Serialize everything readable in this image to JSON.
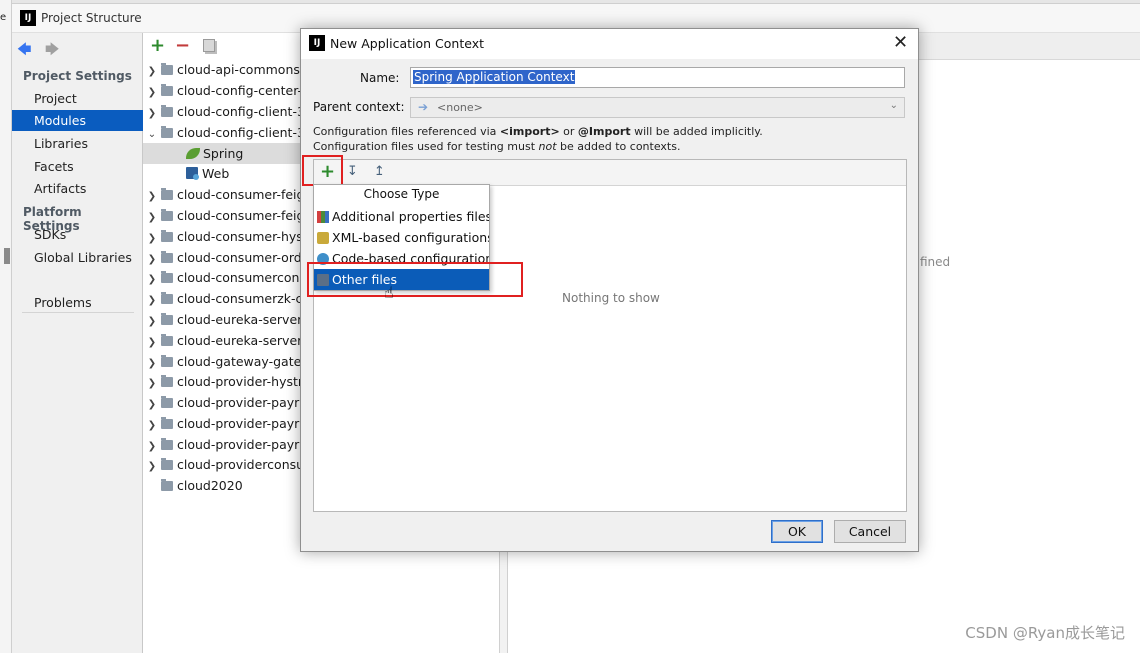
{
  "window": {
    "title": "Project Structure",
    "logo": "IJ",
    "left_fragment": "e"
  },
  "sidebar": {
    "project_settings_header": "Project Settings",
    "project_items": [
      {
        "label": "Project"
      },
      {
        "label": "Modules"
      },
      {
        "label": "Libraries"
      },
      {
        "label": "Facets"
      },
      {
        "label": "Artifacts"
      }
    ],
    "platform_settings_header": "Platform Settings",
    "platform_items": [
      {
        "label": "SDKs"
      },
      {
        "label": "Global Libraries"
      }
    ],
    "problems": "Problems",
    "selected": "Modules"
  },
  "tree": {
    "rows": [
      {
        "label": "cloud-api-commons"
      },
      {
        "label": "cloud-config-center-"
      },
      {
        "label": "cloud-config-client-3"
      },
      {
        "label": "cloud-config-client-3"
      },
      {
        "label": "Spring"
      },
      {
        "label": "Web"
      },
      {
        "label": "cloud-consumer-feig"
      },
      {
        "label": "cloud-consumer-feig"
      },
      {
        "label": "cloud-consumer-hys"
      },
      {
        "label": "cloud-consumer-ord"
      },
      {
        "label": "cloud-consumercons"
      },
      {
        "label": "cloud-consumerzk-c"
      },
      {
        "label": "cloud-eureka-server"
      },
      {
        "label": "cloud-eureka-server"
      },
      {
        "label": "cloud-gateway-gatev"
      },
      {
        "label": "cloud-provider-hystr"
      },
      {
        "label": "cloud-provider-payr"
      },
      {
        "label": "cloud-provider-payr"
      },
      {
        "label": "cloud-provider-payr"
      },
      {
        "label": "cloud-providerconsu"
      },
      {
        "label": "cloud2020"
      }
    ]
  },
  "right_panel": {
    "fragment": "fined"
  },
  "dialog": {
    "title": "New Application Context",
    "logo": "IJ",
    "name_label": "Name:",
    "name_value": "Spring Application Context",
    "parent_label": "Parent context:",
    "parent_value": "<none>",
    "info_line1": {
      "a": "Configuration files referenced via ",
      "b": "<import>",
      "c": " or ",
      "d": "@Import",
      "e": " will be added implicitly."
    },
    "info_line2": {
      "a": "Configuration files used for testing must ",
      "b": "not",
      "c": " be added to contexts."
    },
    "empty_text": "Nothing to show",
    "ok_label": "OK",
    "cancel_label": "Cancel"
  },
  "popup": {
    "title": "Choose Type",
    "items": [
      {
        "label": "Additional properties files"
      },
      {
        "label": "XML-based configurations"
      },
      {
        "label": "Code-based configurations"
      },
      {
        "label": "Other files"
      }
    ],
    "selected": "Other files"
  },
  "watermark": "CSDN @Ryan成长笔记",
  "colors": {
    "selection": "#0a5cbf",
    "highlight_box": "#e02020",
    "add_green": "#2d8a2d"
  }
}
